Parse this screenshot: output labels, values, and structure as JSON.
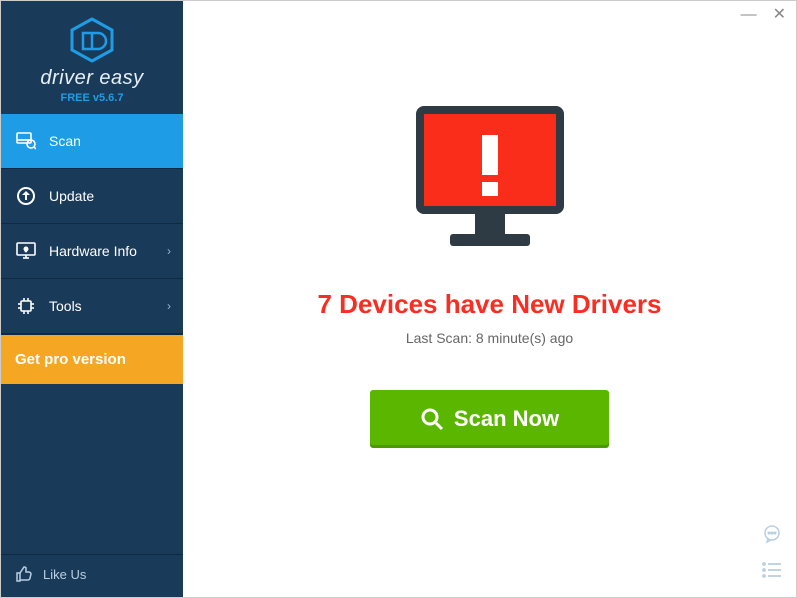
{
  "brand": "driver easy",
  "version": "FREE v5.6.7",
  "nav": {
    "scan": "Scan",
    "update": "Update",
    "hardware": "Hardware Info",
    "tools": "Tools"
  },
  "get_pro": "Get pro version",
  "like_us": "Like Us",
  "main": {
    "headline": "7 Devices have New Drivers",
    "sub": "Last Scan: 8 minute(s) ago",
    "scan_button": "Scan Now"
  }
}
